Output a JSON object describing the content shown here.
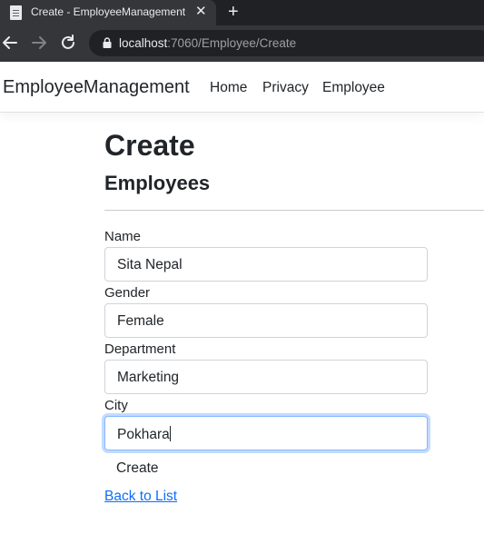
{
  "browser": {
    "tab_title": "Create - EmployeeManagement",
    "tab_close": "✕",
    "new_tab": "+",
    "url_host": "localhost",
    "url_path": ":7060/Employee/Create"
  },
  "navbar": {
    "brand": "EmployeeManagement",
    "links": [
      "Home",
      "Privacy",
      "Employee"
    ]
  },
  "page": {
    "title": "Create",
    "subtitle": "Employees",
    "fields": [
      {
        "label": "Name",
        "value": "Sita Nepal"
      },
      {
        "label": "Gender",
        "value": "Female"
      },
      {
        "label": "Department",
        "value": "Marketing"
      },
      {
        "label": "City",
        "value": "Pokhara"
      }
    ],
    "submit_label": "Create",
    "back_link": "Back to List"
  },
  "colors": {
    "link": "#0d6efd",
    "focus_border": "#86b7fe",
    "chrome_dark": "#202124",
    "chrome_toolbar": "#35363a"
  }
}
